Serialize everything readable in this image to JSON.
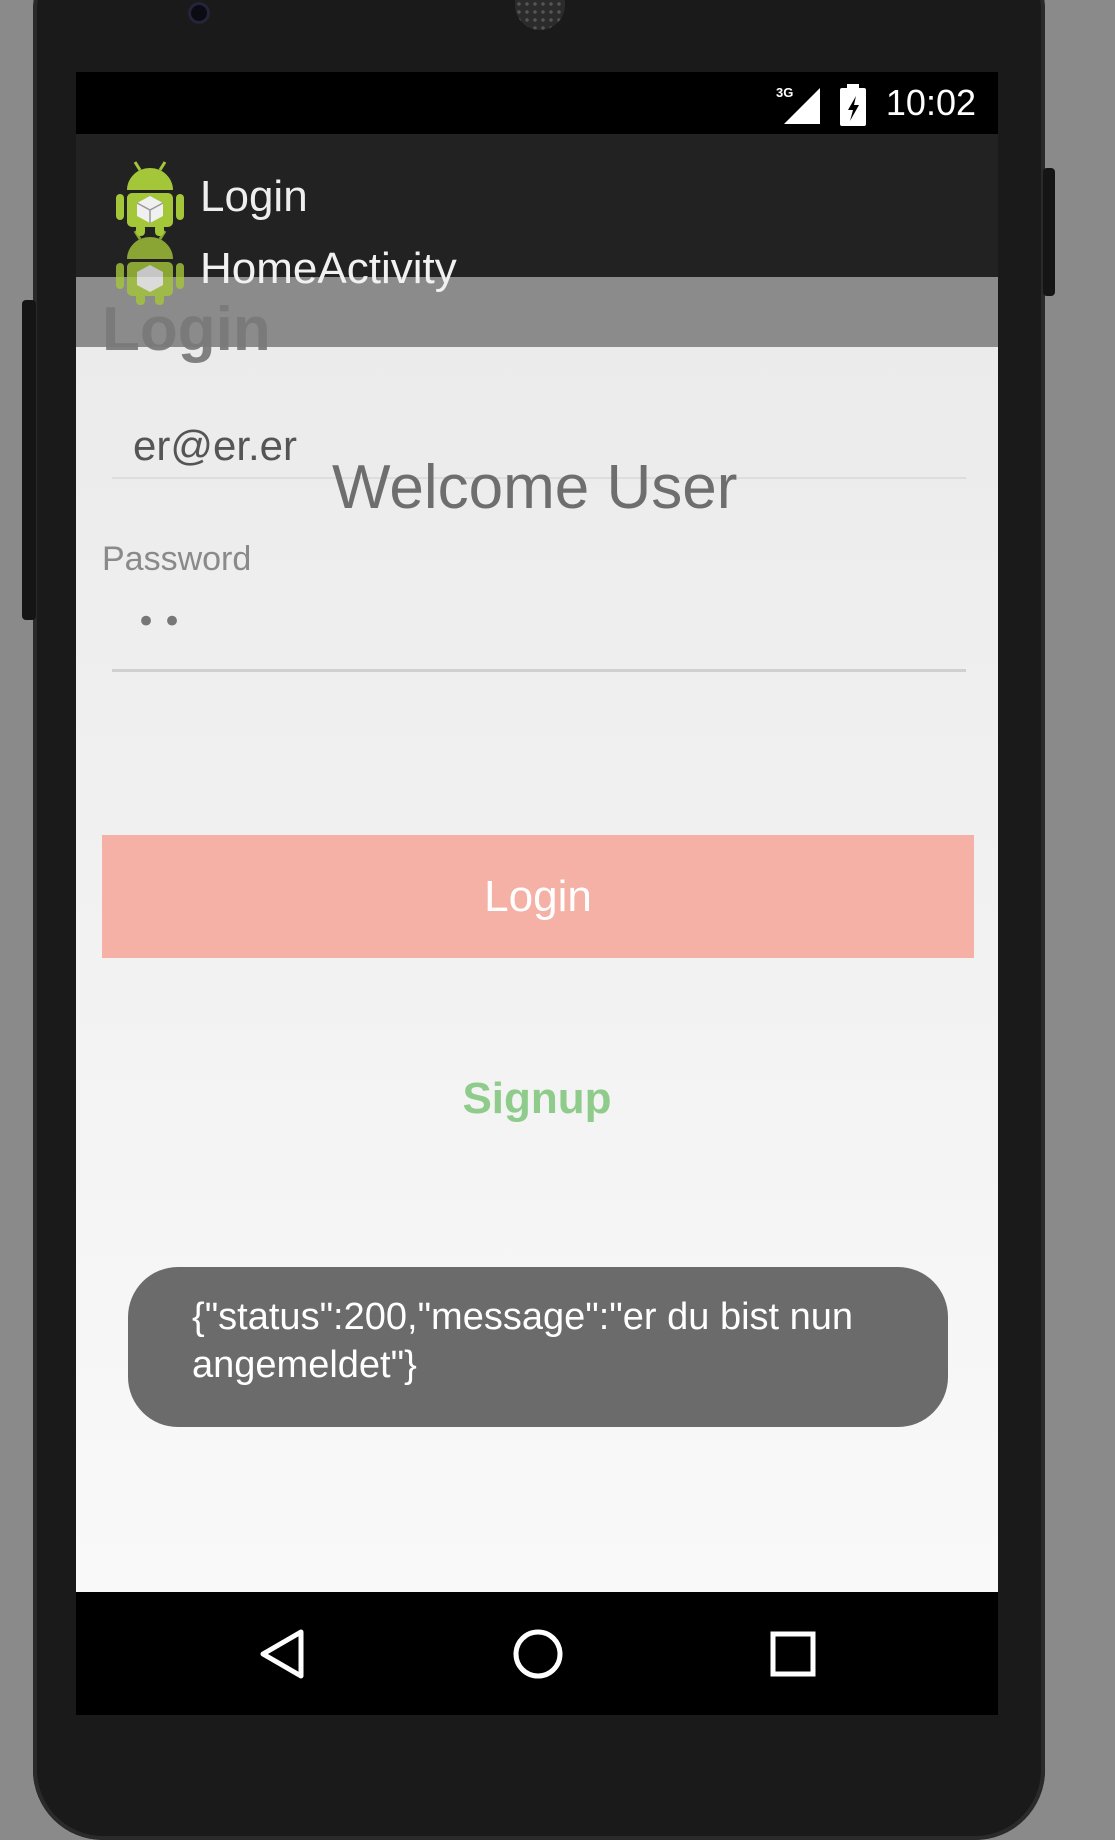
{
  "status_bar": {
    "network": "3G",
    "time": "10:02"
  },
  "recents": {
    "cards": [
      {
        "title": "Login",
        "icon": "android-icon"
      },
      {
        "title": "HomeActivity",
        "icon": "android-icon"
      }
    ]
  },
  "login_screen": {
    "heading": "Login",
    "email_value": "er@er.er",
    "welcome_text": "Welcome User",
    "password_label": "Password",
    "password_value": "••",
    "login_button_label": "Login",
    "signup_label": "Signup"
  },
  "toast": {
    "message": "{\"status\":200,\"message\":\"er du bist nun angemeldet\"}"
  },
  "nav_bar": {
    "buttons": [
      "back-icon",
      "home-icon",
      "recents-icon"
    ]
  },
  "colors": {
    "login_button": "#f5b1a5",
    "signup_text": "#8fcc8c",
    "toast_bg": "#6b6b6b"
  }
}
